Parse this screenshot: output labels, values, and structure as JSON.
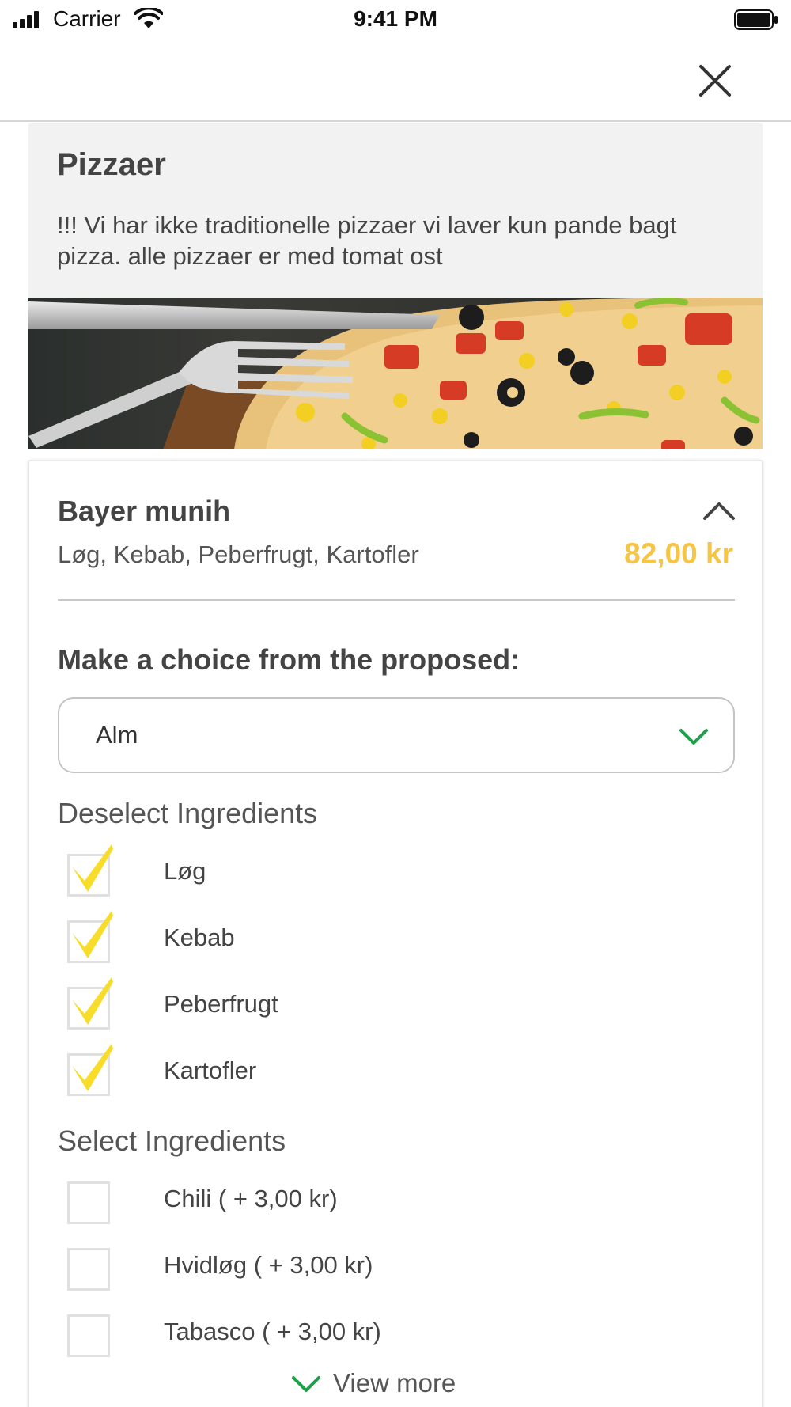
{
  "status_bar": {
    "carrier": "Carrier",
    "time": "9:41 PM"
  },
  "nav": {
    "close_icon": "close-icon"
  },
  "category": {
    "title": "Pizzaer",
    "description": "!!! Vi har ikke traditionelle pizzaer vi laver kun pande bagt pizza. alle pizzaer er med tomat ost"
  },
  "product": {
    "name": "Bayer munih",
    "ingredients": "Løg, Kebab, Peberfrugt, Kartofler",
    "price": "82,00 kr",
    "price_color": "#f6c544"
  },
  "choice": {
    "title": "Make a choice from the proposed:",
    "selected": "Alm"
  },
  "deselect": {
    "title": "Deselect Ingredients",
    "items": [
      {
        "label": "Løg",
        "checked": true
      },
      {
        "label": "Kebab",
        "checked": true
      },
      {
        "label": "Peberfrugt",
        "checked": true
      },
      {
        "label": "Kartofler",
        "checked": true
      }
    ]
  },
  "select": {
    "title": "Select Ingredients",
    "items": [
      {
        "label": "Chili ( + 3,00 kr)",
        "checked": false
      },
      {
        "label": "Hvidløg ( + 3,00 kr)",
        "checked": false
      },
      {
        "label": "Tabasco ( + 3,00 kr)",
        "checked": false
      }
    ]
  },
  "view_more": {
    "label": "View more"
  },
  "colors": {
    "accent_green": "#1ea04a",
    "check_yellow": "#f7dc2a"
  }
}
